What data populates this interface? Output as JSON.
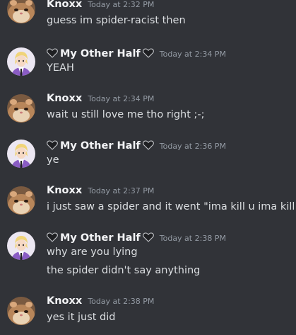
{
  "colors": {
    "background": "#313338",
    "author": "#f2f3f5",
    "text": "#dbdee1",
    "timestamp": "#949ba4",
    "avatar_knoxx": "#b8865a",
    "avatar_other": "#ece7f2",
    "avatar_other_suit": "#8a5cc4",
    "heart": "#1e1f22"
  },
  "messages": [
    {
      "author": "Knoxx",
      "avatar": "hamster-avatar",
      "timestamp": "Today at 2:32 PM",
      "lines": [
        "guess im spider-racist then"
      ]
    },
    {
      "author": "My Other Half",
      "avatar": "anime-boy-avatar",
      "hearts": true,
      "timestamp": "Today at 2:34 PM",
      "lines": [
        "YEAH"
      ]
    },
    {
      "author": "Knoxx",
      "avatar": "hamster-avatar",
      "timestamp": "Today at 2:34 PM",
      "lines": [
        "wait u still love me tho right ;-;"
      ]
    },
    {
      "author": "My Other Half",
      "avatar": "anime-boy-avatar",
      "hearts": true,
      "timestamp": "Today at 2:36 PM",
      "lines": [
        "ye"
      ]
    },
    {
      "author": "Knoxx",
      "avatar": "hamster-avatar",
      "timestamp": "Today at 2:37 PM",
      "lines": [
        "i just saw a spider and it went \"ima kill u ima kill u\""
      ]
    },
    {
      "author": "My Other Half",
      "avatar": "anime-boy-avatar",
      "hearts": true,
      "timestamp": "Today at 2:38 PM",
      "lines": [
        "why are you lying",
        "the spider didn't say anything"
      ]
    },
    {
      "author": "Knoxx",
      "avatar": "hamster-avatar",
      "timestamp": "Today at 2:38 PM",
      "lines": [
        "yes it just did"
      ]
    }
  ]
}
